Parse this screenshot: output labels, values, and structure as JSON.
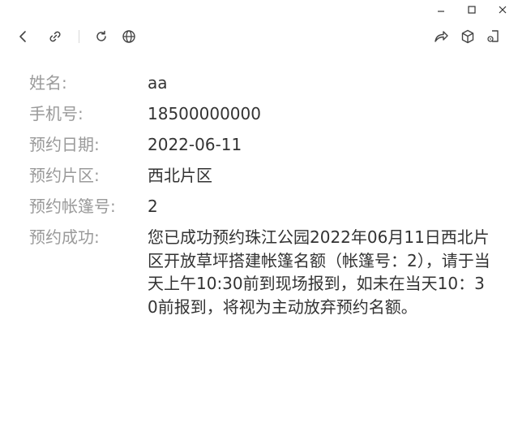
{
  "window_controls": {
    "minimize": "–",
    "maximize": "□",
    "close": "✕"
  },
  "toolbar": {
    "icons": [
      "back-icon",
      "link-icon",
      "refresh-icon",
      "globe-icon",
      "share-icon",
      "cube-icon",
      "mini-program-icon"
    ]
  },
  "fields": {
    "name_label": "姓名:",
    "name_value": "aa",
    "phone_label": "手机号:",
    "phone_value": "18500000000",
    "date_label": "预约日期:",
    "date_value": "2022-06-11",
    "area_label": "预约片区:",
    "area_value": "西北片区",
    "tent_label": "预约帐篷号:",
    "tent_value": "2",
    "success_label": "预约成功:",
    "success_value": "您已成功预约珠江公园2022年06月11日西北片区开放草坪搭建帐篷名额（帐篷号：2），请于当天上午10:30前到现场报到，如未在当天10：30前报到，将视为主动放弃预约名额。"
  }
}
